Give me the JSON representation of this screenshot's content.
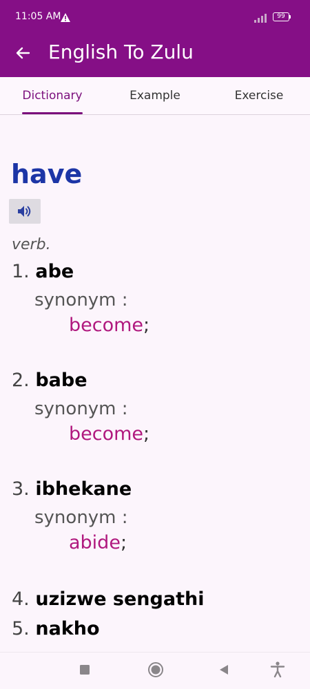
{
  "status": {
    "time": "11:05 AM",
    "battery": "99"
  },
  "appbar": {
    "title": "English To Zulu"
  },
  "tabs": [
    {
      "label": "Dictionary",
      "active": true
    },
    {
      "label": "Example",
      "active": false
    },
    {
      "label": "Exercise",
      "active": false
    }
  ],
  "entry": {
    "word": "have",
    "part_of_speech": "verb.",
    "synonym_label": "synonym :",
    "senses": [
      {
        "number": "1.",
        "term": "abe",
        "synonym": "become"
      },
      {
        "number": "2.",
        "term": "babe",
        "synonym": "become"
      },
      {
        "number": "3.",
        "term": "ibhekane",
        "synonym": "abide"
      },
      {
        "number": "4.",
        "term": "uzizwe sengathi"
      },
      {
        "number": "5.",
        "term": "nakho"
      }
    ],
    "synonym_separator": ";"
  },
  "colors": {
    "primary": "#850f86",
    "word": "#1c35a6",
    "synonym": "#b0187e"
  },
  "icons": [
    "back-arrow-icon",
    "speaker-icon",
    "stop-icon",
    "home-icon",
    "back-triangle-icon",
    "accessibility-icon"
  ]
}
